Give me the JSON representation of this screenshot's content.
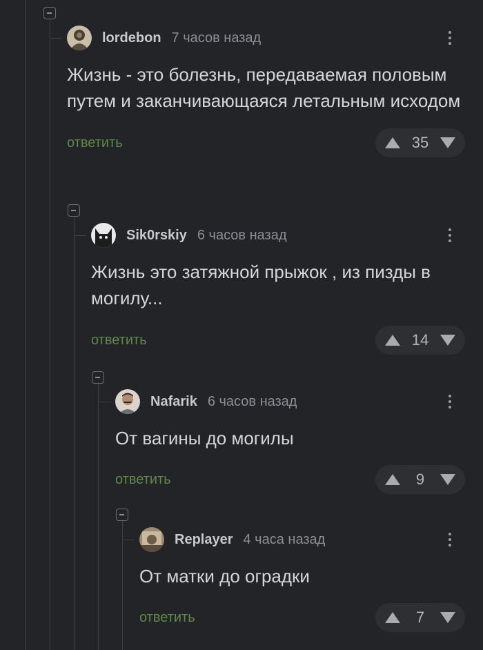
{
  "comments": [
    {
      "username": "lordebon",
      "time": "7 часов назад",
      "text": "Жизнь - это болезнь, передаваемая половым путем и заканчивающаяся летальным исходом",
      "reply_label": "ответить",
      "score": "35"
    },
    {
      "username": "Sik0rskiy",
      "time": "6 часов назад",
      "text": "Жизнь это затяжной прыжок , из пизды в могилу...",
      "reply_label": "ответить",
      "score": "14"
    },
    {
      "username": "Nafarik",
      "time": "6 часов назад",
      "text": "От вагины до могилы",
      "reply_label": "ответить",
      "score": "9"
    },
    {
      "username": "Replayer",
      "time": "4 часа назад",
      "text": "От матки до оградки",
      "reply_label": "ответить",
      "score": "7"
    }
  ],
  "colors": {
    "background": "#232427",
    "reply_link": "#5d8b45",
    "username": "#c7c9cc",
    "timestamp": "#8b8e93"
  },
  "icons": [
    "collapse-icon",
    "avatar",
    "more-vertical-icon",
    "upvote-arrow-icon",
    "downvote-arrow-icon"
  ]
}
